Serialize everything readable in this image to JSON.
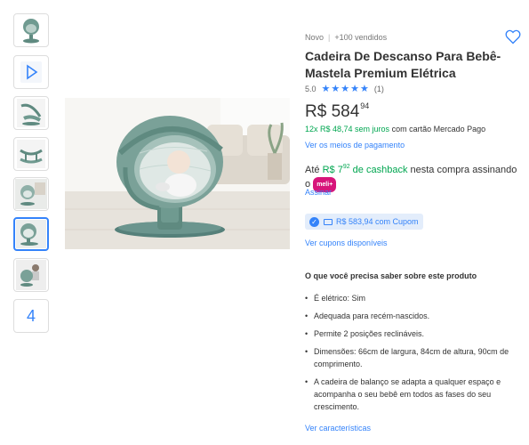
{
  "thumbnails": [
    {
      "kind": "photo",
      "name": "thumb-swing-front"
    },
    {
      "kind": "video",
      "name": "thumb-video"
    },
    {
      "kind": "photo",
      "name": "thumb-swing-side"
    },
    {
      "kind": "photo",
      "name": "thumb-swing-base"
    },
    {
      "kind": "photo",
      "name": "thumb-baby-room"
    },
    {
      "kind": "photo",
      "name": "thumb-baby-swing",
      "active": true
    },
    {
      "kind": "photo",
      "name": "thumb-mother-baby"
    },
    {
      "kind": "more",
      "name": "thumb-more",
      "label": "4"
    }
  ],
  "product": {
    "condition": "Novo",
    "sold": "+100 vendidos",
    "title": "Cadeira De Descanso Para Bebê- Mastela Premium Elétrica",
    "rating_value": "5.0",
    "rating_stars": 5,
    "rating_count": "(1)",
    "price_currency": "R$",
    "price_int": "584",
    "price_cents": "94",
    "installments_prefix": "12x R$ 48,74 sem juros",
    "installments_suffix": " com cartão Mercado Pago",
    "payment_link": "Ver os meios de pagamento",
    "cashback_pre": "Até ",
    "cashback_amount": "R$ 7",
    "cashback_cents": "92",
    "cashback_label": " de cashback",
    "cashback_post": " nesta compra assinando o ",
    "meli_badge": "meli+",
    "subscribe_link": "Assinar",
    "coupon_text": "R$ 583,94 com Cupom",
    "coupons_link": "Ver cupons disponíveis"
  },
  "features": {
    "title": "O que você precisa saber sobre este produto",
    "items": [
      "É elétrico: Sim",
      "Adequada para recém-nascidos.",
      "Permite 2 posições reclináveis.",
      "Dimensões: 66cm de largura, 84cm de altura, 90cm de comprimento.",
      "A cadeira de balanço se adapta a qualquer espaço e acompanha o seu bebê em todos as fases do seu crescimento."
    ],
    "more_link": "Ver características"
  },
  "colors": {
    "accent": "#3483fa",
    "green": "#00a650",
    "meli_pink": "#d7157a",
    "product_green": "#5f8a80"
  },
  "icons": {
    "favorite": "heart-outline-icon",
    "coupon_check": "check-circle-icon",
    "coupon_ticket": "ticket-icon",
    "video": "play-icon"
  }
}
